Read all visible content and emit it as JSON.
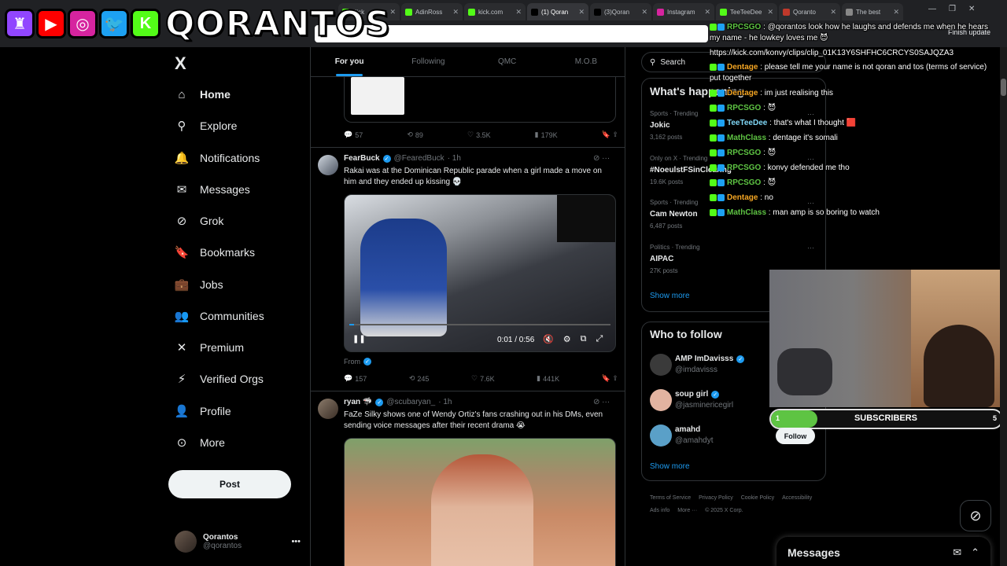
{
  "browser": {
    "tabs": [
      {
        "label": "Kick",
        "color": "#53fc18"
      },
      {
        "label": "AdinRoss",
        "color": "#53fc18"
      },
      {
        "label": "kick.com",
        "color": "#53fc18"
      },
      {
        "label": "(1) Qoran",
        "color": "#000000",
        "active": true
      },
      {
        "label": "(3)Qoran",
        "color": "#000000"
      },
      {
        "label": "Instagram",
        "color": "#d6249f"
      },
      {
        "label": "TeeTeeDee",
        "color": "#53fc18"
      },
      {
        "label": "Qoranto",
        "color": "#c0392b"
      },
      {
        "label": "The best",
        "color": "#888888"
      }
    ],
    "finish_update": "Finish update"
  },
  "overlay": {
    "name": "QORANTOS",
    "icons": [
      {
        "name": "twitch-icon",
        "glyph": "♜",
        "color": "#9146ff"
      },
      {
        "name": "youtube-icon",
        "glyph": "▶",
        "color": "#ff0000"
      },
      {
        "name": "instagram-icon",
        "glyph": "◎",
        "color": "#d6249f"
      },
      {
        "name": "twitter-bird-icon",
        "glyph": "🐦",
        "color": "#1da1f2"
      },
      {
        "name": "kick-icon",
        "glyph": "K",
        "color": "#53fc18"
      }
    ]
  },
  "nav": {
    "logo": "X",
    "items": [
      {
        "label": "Home",
        "icon": "home-icon",
        "glyph": "⌂",
        "active": true
      },
      {
        "label": "Explore",
        "icon": "search-icon",
        "glyph": "⚲"
      },
      {
        "label": "Notifications",
        "icon": "bell-icon",
        "glyph": "🔔"
      },
      {
        "label": "Messages",
        "icon": "mail-icon",
        "glyph": "✉"
      },
      {
        "label": "Grok",
        "icon": "grok-icon",
        "glyph": "⊘"
      },
      {
        "label": "Bookmarks",
        "icon": "bookmark-icon",
        "glyph": "🔖"
      },
      {
        "label": "Jobs",
        "icon": "briefcase-icon",
        "glyph": "💼"
      },
      {
        "label": "Communities",
        "icon": "people-icon",
        "glyph": "👥"
      },
      {
        "label": "Premium",
        "icon": "x-premium-icon",
        "glyph": "✕"
      },
      {
        "label": "Verified Orgs",
        "icon": "lightning-icon",
        "glyph": "⚡"
      },
      {
        "label": "Profile",
        "icon": "person-icon",
        "glyph": "👤"
      },
      {
        "label": "More",
        "icon": "more-circle-icon",
        "glyph": "⊙"
      }
    ],
    "post_label": "Post",
    "profile": {
      "name": "Qorantos",
      "handle": "@qorantos"
    }
  },
  "feed": {
    "tabs": [
      "For you",
      "Following",
      "QMC",
      "M.O.B"
    ],
    "tweet0": {
      "replies": "57",
      "reposts": "89",
      "likes": "3.5K",
      "views": "179K"
    },
    "tweet1": {
      "name": "FearBuck",
      "handle": "@FearedBuck",
      "time": "· 1h",
      "text": "Rakai was at the Dominican Republic parade when a girl made a move on him and they ended up kissing 💀",
      "video_time": "0:01 / 0:56",
      "video_progress": 0.018,
      "from_label": "From",
      "replies": "157",
      "reposts": "245",
      "likes": "7.6K",
      "views": "441K"
    },
    "tweet2": {
      "name": "ryan 🦈",
      "handle": "@scubaryan_",
      "time": "· 1h",
      "text": "FaZe Silky shows one of Wendy Ortiz's fans crashing out in his DMs, even sending voice messages after their recent drama 😭"
    }
  },
  "right": {
    "search_placeholder": "Search",
    "trends_title": "What's happening",
    "trends": [
      {
        "meta": "Sports · Trending",
        "name": "Jokic",
        "count": "3,162 posts"
      },
      {
        "meta": "Only on X · Trending",
        "name": "#NoeulstFSinClearing",
        "count": "19.6K posts"
      },
      {
        "meta": "Sports · Trending",
        "name": "Cam Newton",
        "count": "6,487 posts"
      },
      {
        "meta": "Politics · Trending",
        "name": "AIPAC",
        "count": "27K posts"
      }
    ],
    "show_more": "Show more",
    "wtf_title": "Who to follow",
    "wtf": [
      {
        "name": "AMP ImDavisss",
        "handle": "@imdavisss"
      },
      {
        "name": "soup girl",
        "handle": "@jasminericegirl"
      },
      {
        "name": "amahd",
        "handle": "@amahdyt"
      }
    ],
    "follow_label": "Follow",
    "footer": [
      "Terms of Service",
      "Privacy Policy",
      "Cookie Policy",
      "Accessibility",
      "Ads info",
      "More ···",
      "© 2025 X Corp."
    ]
  },
  "chat": [
    {
      "user": "RPCSGO",
      "color": "#5ec443",
      "msg": "@qorantos look how he laughs and defends me when he hears my name - he lowkey loves me 😈",
      "wrap": true
    },
    {
      "user": "",
      "color": "#ffffff",
      "msg": "https://kick.com/konvy/clips/clip_01K13Y6SHFHC6CRCYS0SAJQZA3",
      "wrap": false
    },
    {
      "user": "Dentage",
      "color": "#f5a623",
      "msg": "please tell me your name is not qoran and tos (terms of service) put together",
      "wrap": true
    },
    {
      "user": "Dentage",
      "color": "#f5a623",
      "msg": "im just realising this",
      "wrap": false
    },
    {
      "user": "RPCSGO",
      "color": "#5ec443",
      "msg": "😈",
      "wrap": false
    },
    {
      "user": "TeeTeeDee",
      "color": "#7fd6f5",
      "msg": "that's what I thought 🟥",
      "wrap": false
    },
    {
      "user": "MathClass",
      "color": "#5ec443",
      "msg": "dentage it's somali",
      "wrap": false
    },
    {
      "user": "RPCSGO",
      "color": "#5ec443",
      "msg": "😈",
      "wrap": false
    },
    {
      "user": "RPCSGO",
      "color": "#5ec443",
      "msg": "konvy defended me tho",
      "wrap": false
    },
    {
      "user": "RPCSGO",
      "color": "#5ec443",
      "msg": "😈",
      "wrap": false
    },
    {
      "user": "Dentage",
      "color": "#f5a623",
      "msg": "no",
      "wrap": false
    },
    {
      "user": "MathClass",
      "color": "#5ec443",
      "msg": "man amp is so boring to watch",
      "wrap": false
    }
  ],
  "subs": {
    "label": "SUBSCRIBERS",
    "start": "1",
    "end": "5",
    "progress": 0.2
  },
  "messages_drawer": {
    "title": "Messages"
  }
}
